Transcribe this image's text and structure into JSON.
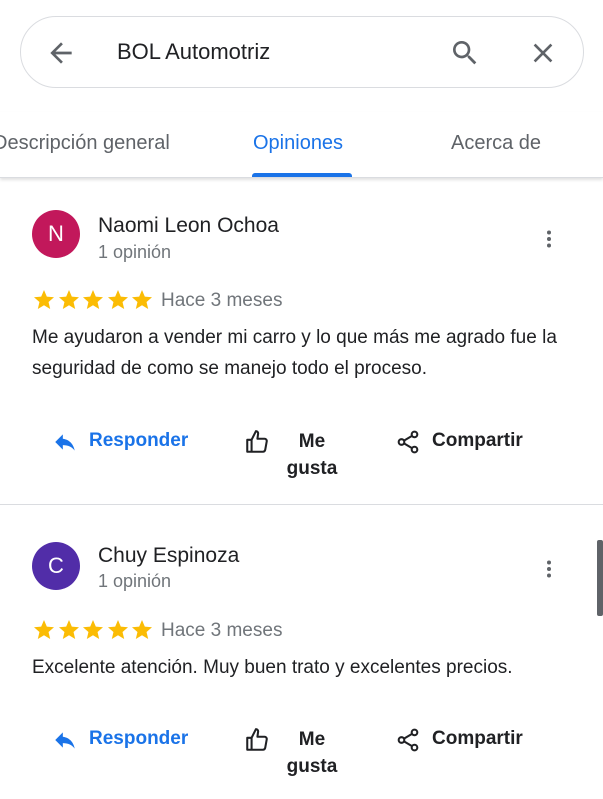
{
  "search": {
    "query": "BOL Automotriz",
    "back_icon": "arrow-back-icon",
    "search_icon": "search-icon",
    "close_icon": "close-icon"
  },
  "tabs": [
    {
      "label": "Descripción general",
      "active": false
    },
    {
      "label": "Opiniones",
      "active": true
    },
    {
      "label": "Acerca de",
      "active": false
    }
  ],
  "colors": {
    "accent": "#1a73e8",
    "star": "#fbbc04",
    "avatar_1": "#c2185b",
    "avatar_2": "#512da8"
  },
  "reviews": [
    {
      "initial": "N",
      "author": "Naomi Leon Ochoa",
      "count": "1 opinión",
      "rating": 5,
      "date": "Hace 3 meses",
      "text": "Me ayudaron a vender mi carro y lo que más me agrado fue la seguridad de como se manejo todo el proceso.",
      "actions": {
        "reply": "Responder",
        "like": "Me gusta",
        "share": "Compartir"
      }
    },
    {
      "initial": "C",
      "author": "Chuy Espinoza",
      "count": "1 opinión",
      "rating": 5,
      "date": "Hace 3 meses",
      "text": "Excelente atención. Muy buen trato y excelentes precios.",
      "actions": {
        "reply": "Responder",
        "like": "Me gusta",
        "share": "Compartir"
      }
    }
  ]
}
